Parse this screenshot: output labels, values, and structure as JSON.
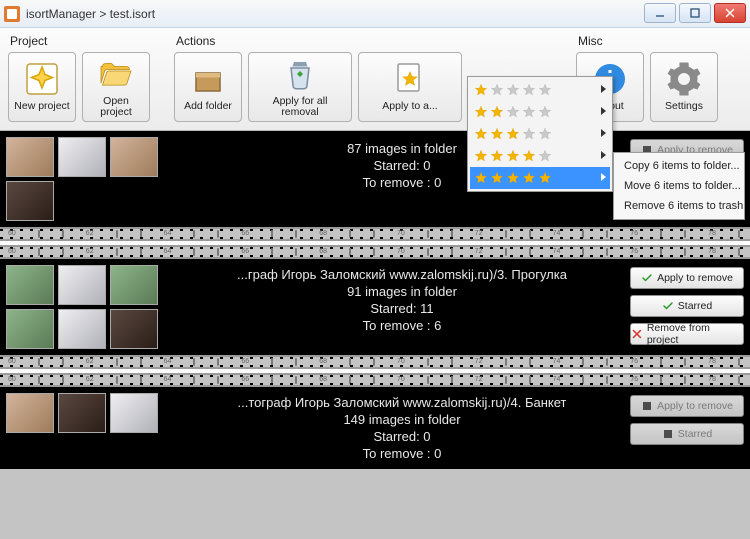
{
  "window": {
    "title": "isortManager > test.isort"
  },
  "toolbar": {
    "groups": {
      "project": {
        "header": "Project"
      },
      "actions": {
        "header": "Actions"
      },
      "misc": {
        "header": "Misc"
      }
    },
    "buttons": {
      "new_project": "New project",
      "open_project": "Open project",
      "add_folder": "Add folder",
      "apply_removal": "Apply for all removal",
      "apply_stars": "Apply to a...",
      "about": "About",
      "settings": "Settings"
    }
  },
  "star_menu": {
    "rows": [
      {
        "count": 1
      },
      {
        "count": 2
      },
      {
        "count": 3
      },
      {
        "count": 4
      },
      {
        "count": 5,
        "selected": true
      }
    ]
  },
  "context_menu": {
    "items": {
      "copy": "Copy 6 items to folder...",
      "move": "Move 6 items to folder...",
      "remove": "Remove 6 items to trash"
    }
  },
  "strips": [
    {
      "folder": "",
      "images_line": "87 images in folder",
      "starred_line": "Starred: 0",
      "remove_line": "To remove : 0",
      "buttons": {
        "apply": "Apply to remove"
      },
      "button_states": {
        "apply_disabled": true
      }
    },
    {
      "folder": "...граф Игорь Заломский www.zalomskij.ru)/3. Прогулка",
      "images_line": "91 images in folder",
      "starred_line": "Starred: 11",
      "remove_line": "To remove : 6",
      "buttons": {
        "apply": "Apply to remove",
        "starred": "Starred",
        "remove": "Remove from project"
      }
    },
    {
      "folder": "...тограф Игорь Заломский www.zalomskij.ru)/4. Банкет",
      "images_line": "149 images in folder",
      "starred_line": "Starred: 0",
      "remove_line": "To remove : 0",
      "buttons": {
        "apply": "Apply to remove",
        "starred": "Starred"
      },
      "button_states": {
        "apply_disabled": true,
        "starred_disabled": true
      }
    }
  ]
}
